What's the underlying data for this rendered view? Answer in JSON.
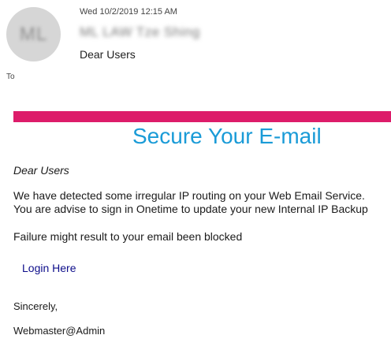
{
  "header": {
    "avatar_initials": "ML",
    "timestamp": "Wed 10/2/2019 12:15 AM",
    "sender": "ML LAW Tze Shing",
    "subject": "Dear Users",
    "to_label": "To"
  },
  "message": {
    "banner_color": "#dd1c6a",
    "headline": "Secure Your E-mail",
    "headline_color": "#1a9bd7",
    "greeting": "Dear Users",
    "body_lines": [
      "We have detected some irregular IP routing on your Web Email Service.",
      "You are advise to sign in Onetime to update your new Internal IP Backup"
    ],
    "warning": "Failure might result to your email been blocked",
    "link_label": "Login Here",
    "signoff": "Sincerely,",
    "signature": "Webmaster@Admin"
  }
}
